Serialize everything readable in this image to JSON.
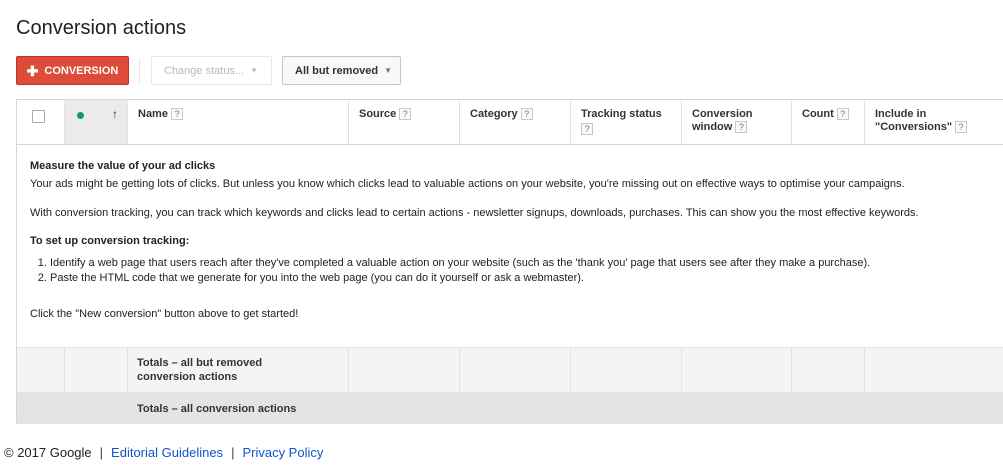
{
  "page_title": "Conversion actions",
  "toolbar": {
    "add_button_label": "CONVERSION",
    "status_dropdown_label": "Change status...",
    "filter_dropdown_label": "All but removed"
  },
  "columns": {
    "name": "Name",
    "source": "Source",
    "category": "Category",
    "tracking_status": "Tracking status",
    "conversion_window_l1": "Conversion",
    "conversion_window_l2": "window",
    "count": "Count",
    "include_l1": "Include in",
    "include_l2": "\"Conversions\"",
    "help_mark": "?"
  },
  "message": {
    "heading": "Measure the value of your ad clicks",
    "para1": "Your ads might be getting lots of clicks. But unless you know which clicks lead to valuable actions on your website, you're missing out on effective ways to optimise your campaigns.",
    "para2": "With conversion tracking, you can track which keywords and clicks lead to certain actions - newsletter signups, downloads, purchases. This can show you the most effective keywords.",
    "setup_heading": "To set up conversion tracking:",
    "step1": "Identify a web page that users reach after they've completed a valuable action on your website (such as the 'thank you' page that users see after they make a purchase).",
    "step2": "Paste the HTML code that we generate for you into the web page (you can do it yourself or ask a webmaster).",
    "cta": "Click the \"New conversion\" button above to get started!"
  },
  "totals": {
    "row1_l1": "Totals – all but removed",
    "row1_l2": "conversion actions",
    "row2": "Totals – all conversion actions"
  },
  "footer": {
    "copyright": "© 2017 Google",
    "editorial_link": "Editorial Guidelines",
    "privacy_link": "Privacy Policy",
    "separator": "|"
  },
  "colors": {
    "accent_red": "#dd4b39",
    "link_blue": "#1155cc",
    "status_green": "#0f9d58"
  }
}
